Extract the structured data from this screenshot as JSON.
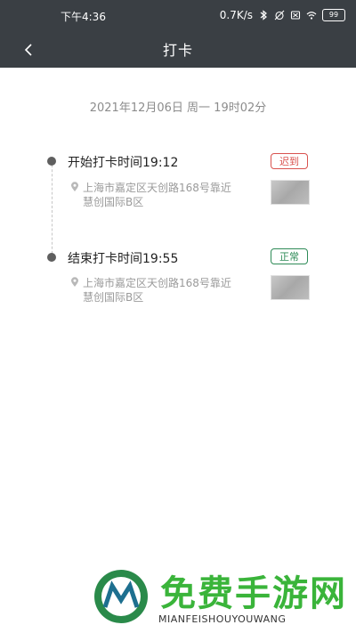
{
  "status_bar": {
    "time": "下午4:36",
    "network_speed": "0.7K/s",
    "battery": "99"
  },
  "header": {
    "title": "打卡"
  },
  "date_line": "2021年12月06日 周一 19时02分",
  "records": [
    {
      "label": "开始打卡时间19:12",
      "status": "迟到",
      "status_color": "#d9534f",
      "address": "上海市嘉定区天创路168号靠近慧创国际B区"
    },
    {
      "label": "结束打卡时间19:55",
      "status": "正常",
      "status_color": "#2e8b57",
      "address": "上海市嘉定区天创路168号靠近慧创国际B区"
    }
  ],
  "watermark": {
    "title": "免费手游网",
    "subtitle": "MIANFEISHOUYOUWANG"
  },
  "colors": {
    "topbar": "#3a3f44",
    "brand_green": "#3ab43a"
  }
}
